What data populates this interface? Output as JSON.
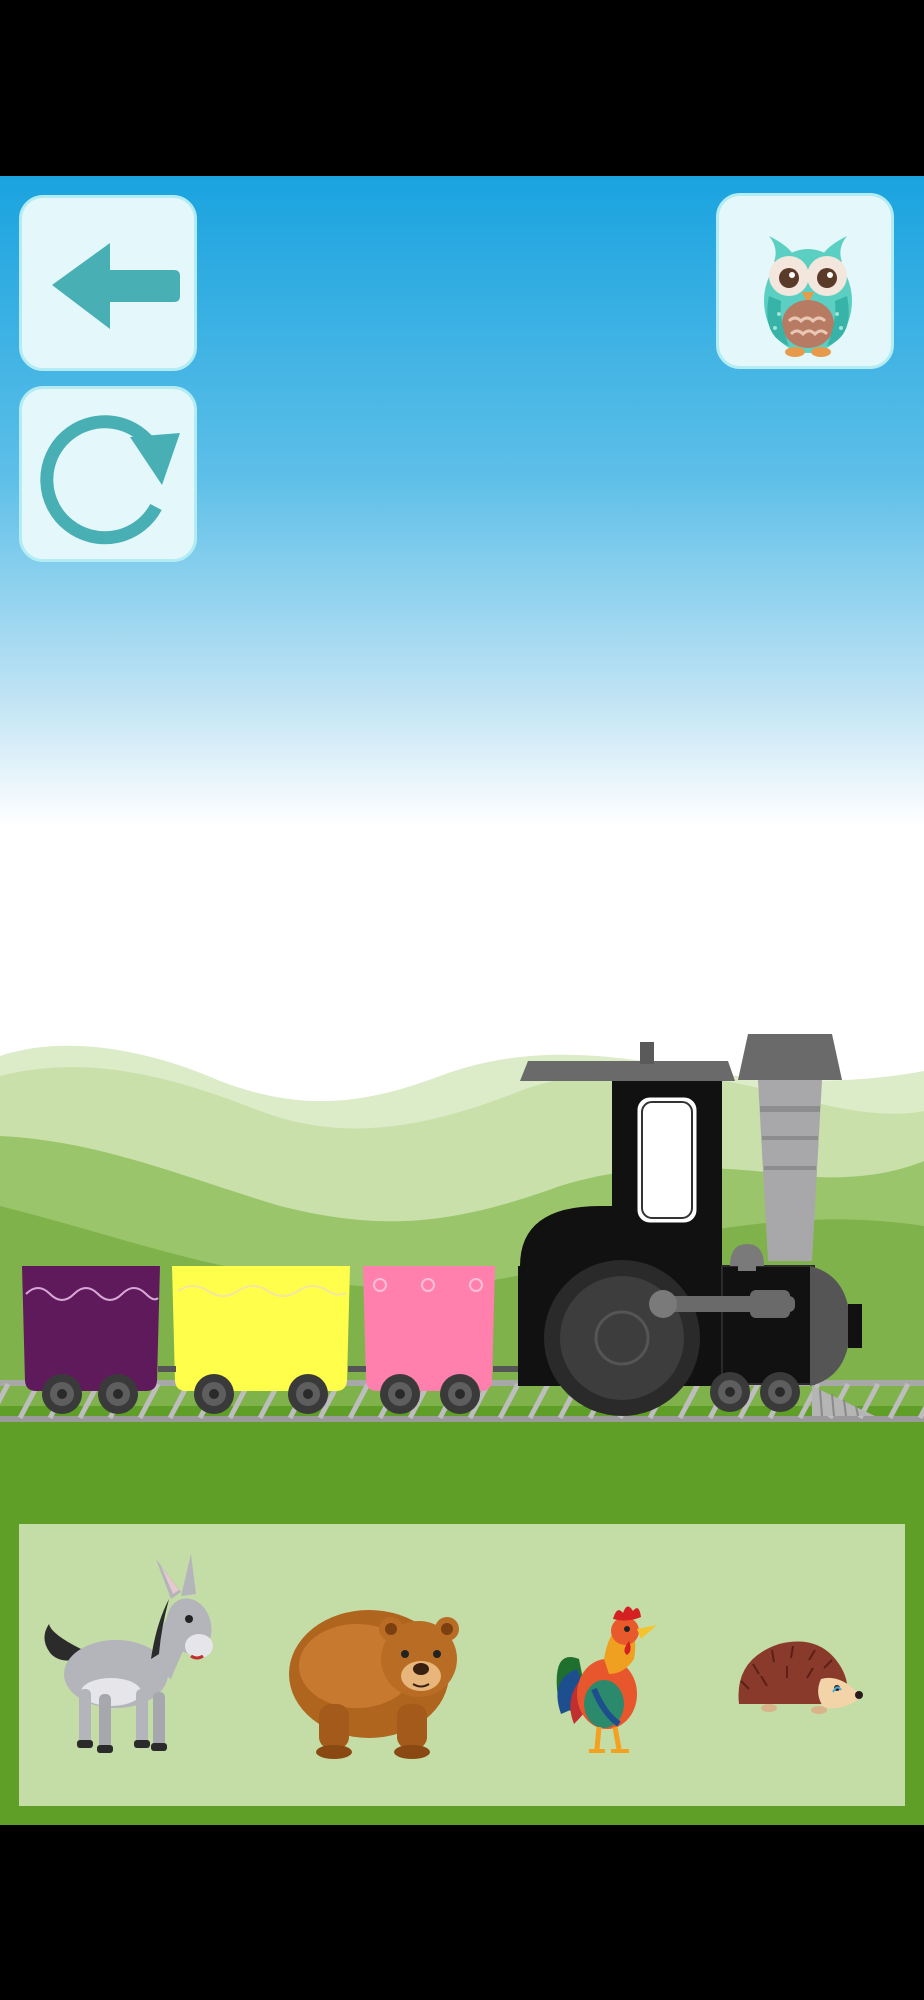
{
  "screen": {
    "name": "animal-train-game",
    "background_colors": {
      "sky_top": "#1aa3df",
      "sky_bottom": "#ffffff",
      "grass": "#5f9e27",
      "tray": "#c4dca5"
    }
  },
  "controls": {
    "back_icon": "arrow-left-icon",
    "restart_icon": "refresh-icon",
    "mascot_icon": "owl-icon",
    "accent_color": "#48afb5"
  },
  "train": {
    "wagons": [
      {
        "color": "#5f1a5b",
        "state": "empty"
      },
      {
        "color": "#ffff4b",
        "state": "empty"
      },
      {
        "color": "#ff80ad",
        "state": "empty"
      }
    ],
    "locomotive_color": "#111111"
  },
  "animals": [
    {
      "name": "donkey"
    },
    {
      "name": "bear"
    },
    {
      "name": "rooster"
    },
    {
      "name": "hedgehog"
    }
  ]
}
